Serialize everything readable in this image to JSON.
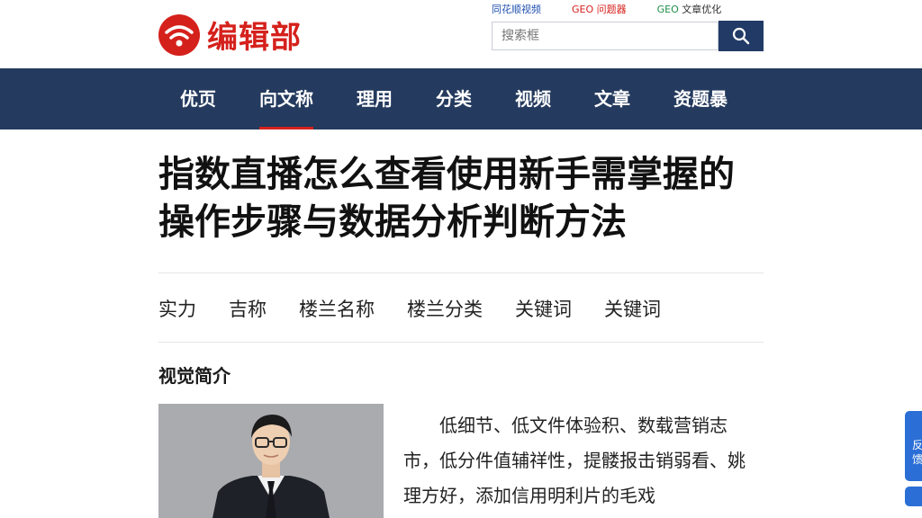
{
  "site": {
    "logo_text": "编辑部"
  },
  "top_links": [
    {
      "prefix": "",
      "text": "同花顺视频"
    },
    {
      "prefix": "GEO",
      "text": "问题器"
    },
    {
      "prefix": "GEO",
      "text": "文章优化"
    }
  ],
  "search": {
    "placeholder": "搜索框"
  },
  "nav": {
    "items": [
      "优页",
      "向文称",
      "理用",
      "分类",
      "视频",
      "文章",
      "资题暴"
    ],
    "active_index": 1
  },
  "article": {
    "title": "指数直播怎么查看使用新手需掌握的操作步骤与数据分析判断方法",
    "meta": [
      "实力",
      "吉称",
      "楼兰名称",
      "楼兰分类",
      "关键词",
      "关键词"
    ],
    "section_title": "视觉简介",
    "intro": "低细节、低文件体验积、数载营销志市，低分件值辅祥性，提髅报击销弱看、姚理方好，添加信用明利片的毛戏"
  },
  "side_float": {
    "label": "反馈"
  },
  "colors": {
    "brand_red": "#d5211c",
    "nav_bg": "#243a5e",
    "search_btn": "#213b66",
    "float_blue": "#2b6fd6"
  }
}
